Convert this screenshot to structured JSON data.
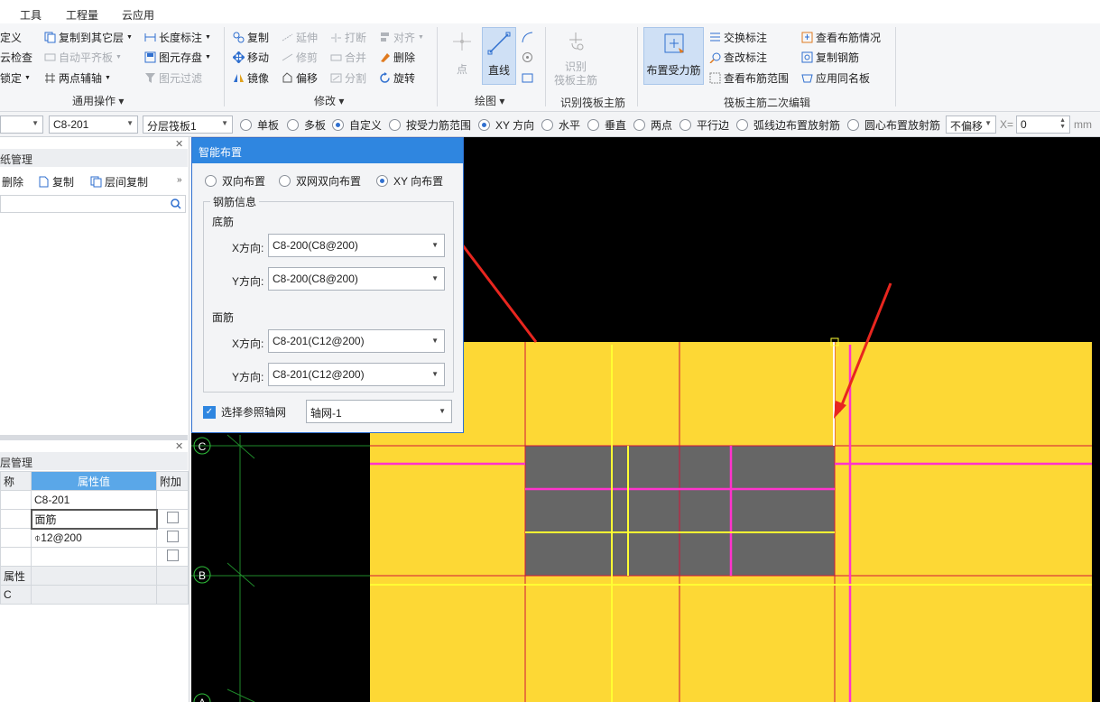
{
  "menu": {
    "items": [
      "工具",
      "工程量",
      "云应用"
    ]
  },
  "ribbon": {
    "col1": [
      "定义",
      "云检查",
      "锁定"
    ],
    "col2": [
      "复制到其它层",
      "自动平齐板",
      "两点辅轴"
    ],
    "col3": [
      "长度标注",
      "图元存盘",
      "图元过滤"
    ],
    "group_general": "通用操作",
    "modify": {
      "copy": "复制",
      "extend": "延伸",
      "break": "打断",
      "align": "对齐",
      "move": "移动",
      "trim": "修剪",
      "merge": "合并",
      "delete": "删除",
      "mirror": "镜像",
      "offset": "偏移",
      "split": "分割",
      "rotate": "旋转"
    },
    "group_modify": "修改",
    "draw_point": "点",
    "draw_line": "直线",
    "group_draw": "绘图",
    "identify_label": [
      "识别",
      "筏板主筋"
    ],
    "group_identify": "识别筏板主筋",
    "arrange": "布置受力筋",
    "exchange": "交换标注",
    "check_label": "查改标注",
    "view_range": "查看布筋范围",
    "view_status": "查看布筋情况",
    "copy_rebar": "复制钢筋",
    "apply_same": "应用同名板",
    "group_edit": "筏板主筋二次编辑"
  },
  "propbar": {
    "sel1": "",
    "sel2": "C8-201",
    "sel3": "分层筏板1",
    "radios": [
      "单板",
      "多板",
      "自定义",
      "按受力筋范围",
      "XY 方向",
      "水平",
      "垂直",
      "两点",
      "平行边",
      "弧线边布置放射筋",
      "圆心布置放射筋"
    ],
    "offset": "不偏移",
    "x_label": "X=",
    "x_value": "0",
    "unit": "mm"
  },
  "left_top": {
    "title": "纸管理",
    "delete": "删除",
    "copy": "复制",
    "floor_copy": "层间复制"
  },
  "left_bottom": {
    "title": "层管理",
    "headers": [
      "称",
      "属性值",
      "附加"
    ],
    "rows": [
      {
        "name": "",
        "value": "C8-201"
      },
      {
        "name": "",
        "value": "面筋"
      },
      {
        "name": "",
        "value": "⌽12@200"
      },
      {
        "name": "",
        "value": ""
      },
      {
        "name": "属性",
        "value": ""
      },
      {
        "name": "C",
        "value": ""
      }
    ]
  },
  "dialog": {
    "title": "智能布置",
    "mode_options": [
      "双向布置",
      "双网双向布置",
      "XY 向布置"
    ],
    "group_title": "钢筋信息",
    "bottom_label": "底筋",
    "top_label": "面筋",
    "x_dir": "X方向:",
    "y_dir": "Y方向:",
    "bottom_x": "C8-200(C8@200)",
    "bottom_y": "C8-200(C8@200)",
    "top_x": "C8-201(C12@200)",
    "top_y": "C8-201(C12@200)",
    "ref_grid_label": "选择参照轴网",
    "ref_grid_value": "轴网-1"
  },
  "canvas": {
    "axis_labels": [
      "C",
      "B",
      "A"
    ]
  },
  "colors": {
    "accent": "#2f86e0",
    "slab": "#fdd835",
    "hole": "#666666",
    "arrow": "#e8261f"
  }
}
